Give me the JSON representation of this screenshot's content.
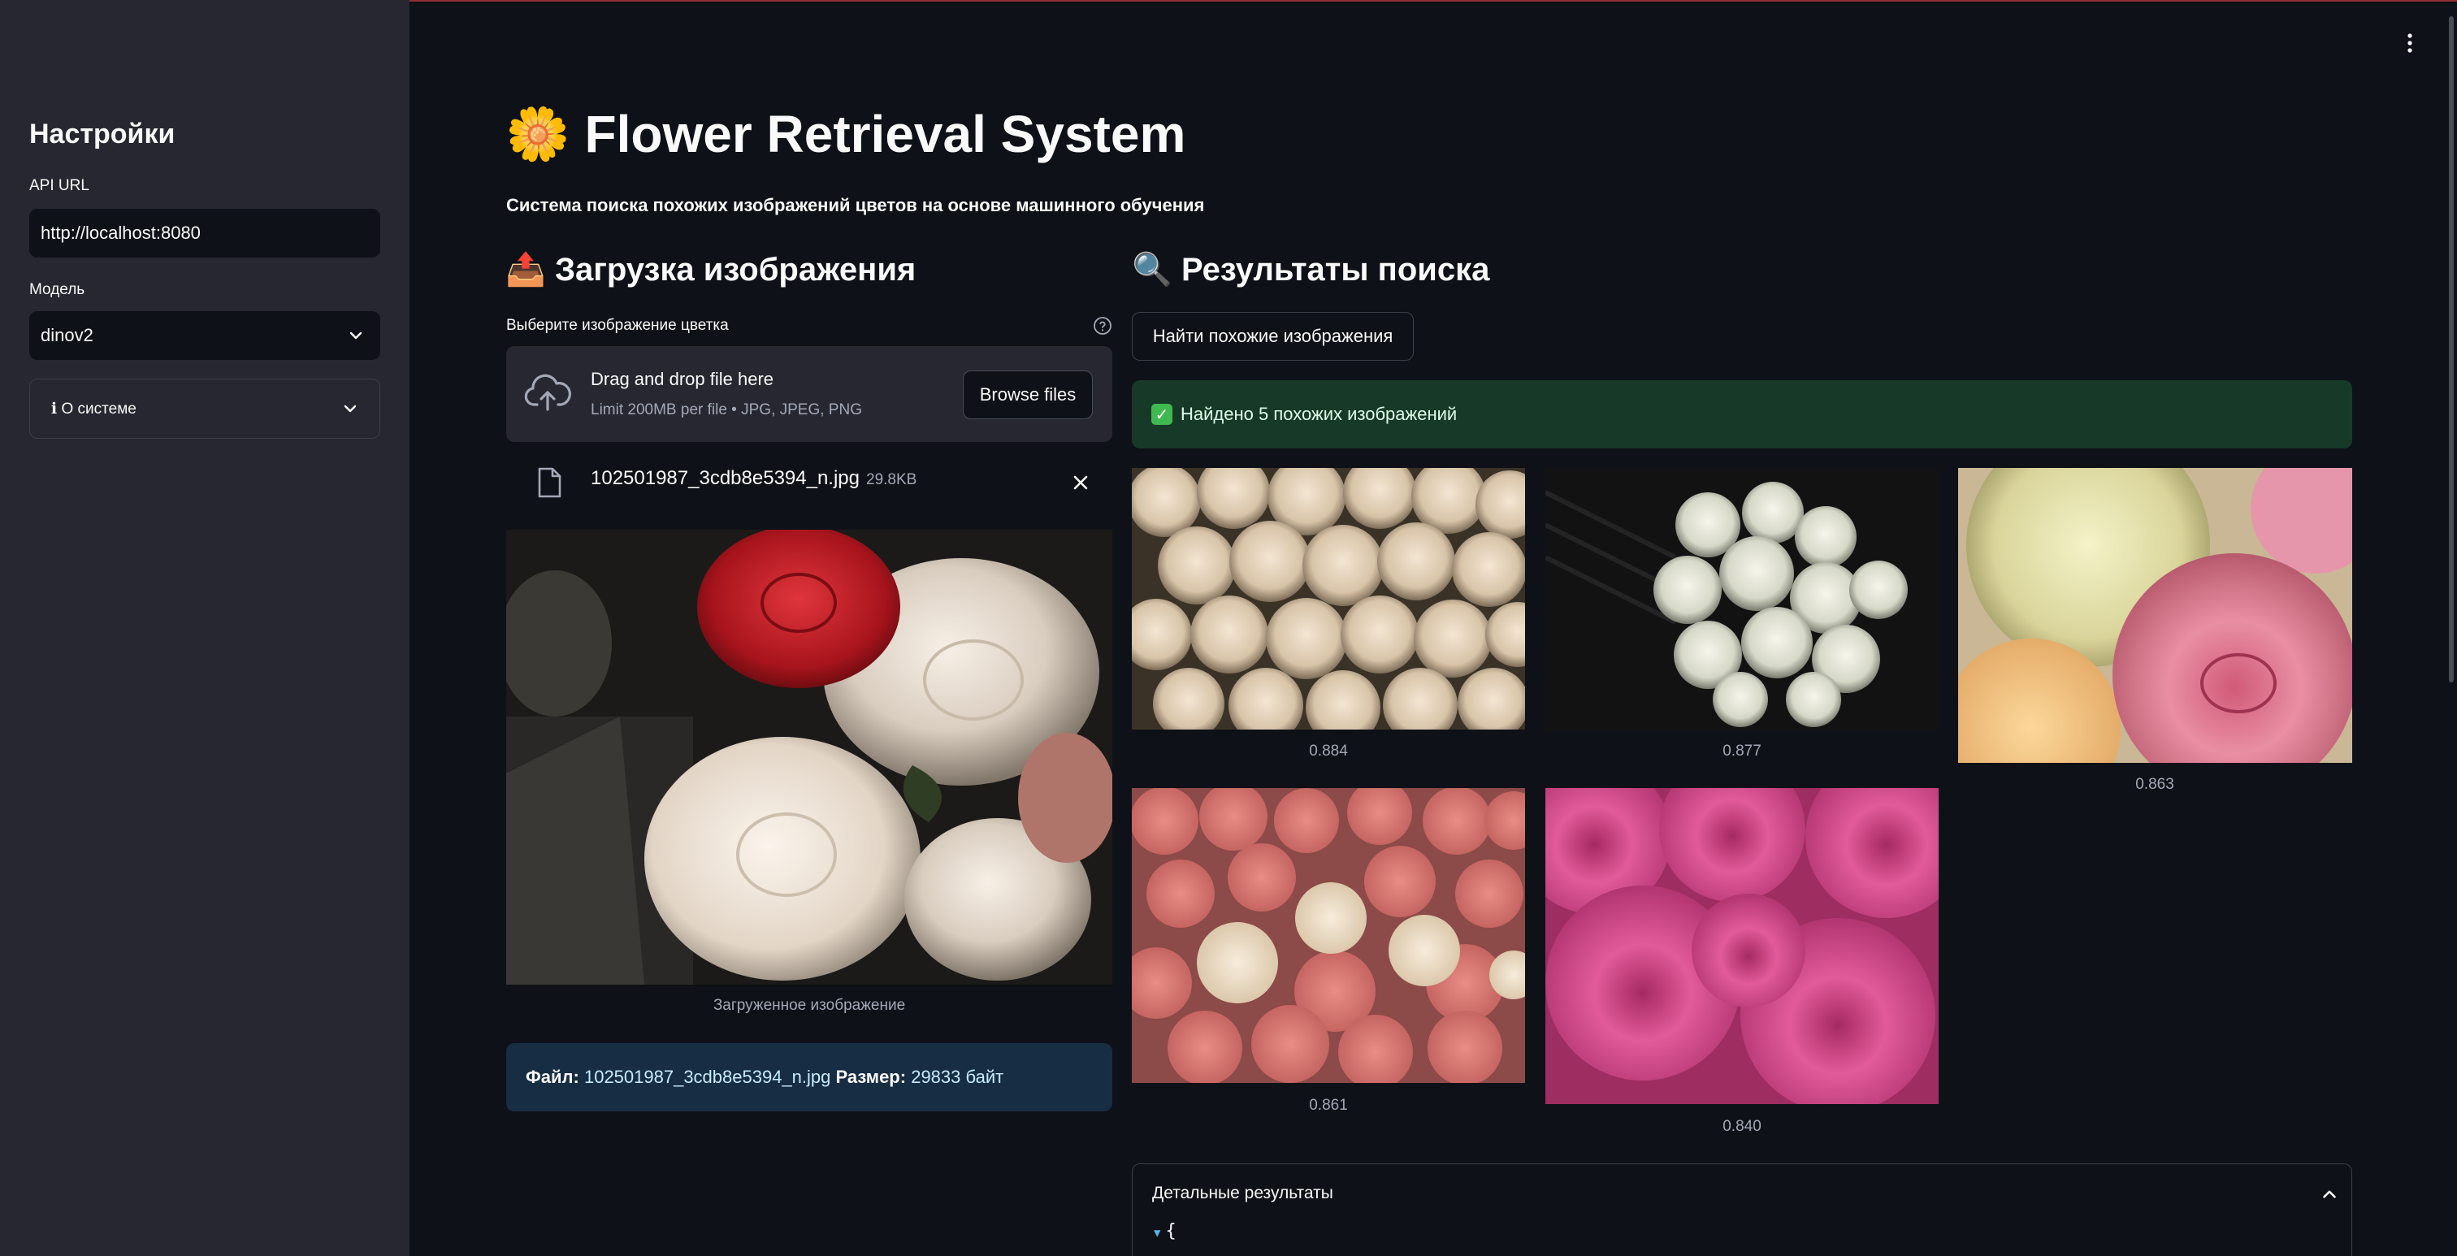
{
  "sidebar": {
    "title": "Настройки",
    "api_url_label": "API URL",
    "api_url_value": "http://localhost:8080",
    "model_label": "Модель",
    "model_value": "dinov2",
    "about_expander": "ℹ О системе"
  },
  "header": {
    "title": "Flower Retrieval System",
    "title_icon": "🌼",
    "subtitle": "Система поиска похожих изображений цветов на основе машинного обучения"
  },
  "upload": {
    "heading": "Загрузка изображения",
    "heading_icon": "📤",
    "uploader_label": "Выберите изображение цветка",
    "dropzone_main": "Drag and drop file here",
    "dropzone_sub": "Limit 200MB per file • JPG, JPEG, PNG",
    "browse_button": "Browse files",
    "file_name": "102501987_3cdb8e5394_n.jpg",
    "file_size": "29.8KB",
    "image_caption": "Загруженное изображение",
    "info_file_label": "Файл:",
    "info_file_value": "102501987_3cdb8e5394_n.jpg",
    "info_size_label": "Размер:",
    "info_size_value": "29833 байт"
  },
  "results": {
    "heading": "Результаты поиска",
    "heading_icon": "🔍",
    "find_button": "Найти похожие изображения",
    "success_message": "Найдено 5 похожих изображений",
    "scores": [
      "0.884",
      "0.877",
      "0.863",
      "0.861",
      "0.840"
    ],
    "details_label": "Детальные результаты",
    "json_preview": "{"
  },
  "colors": {
    "background": "#0e1117",
    "sidebar": "#262730",
    "info_bg": "#172d43",
    "success_bg": "#173928"
  }
}
